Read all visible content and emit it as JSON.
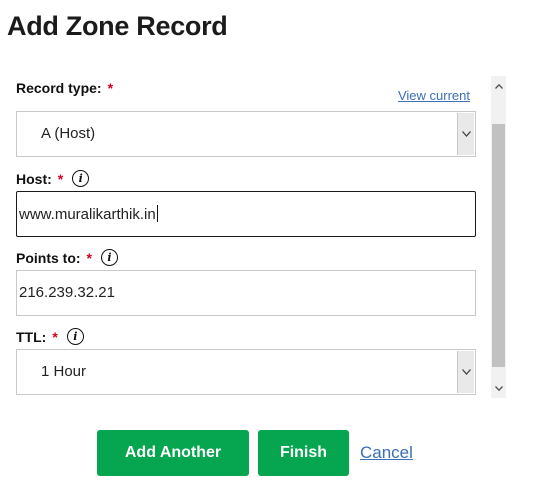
{
  "header": {
    "title": "Add Zone Record"
  },
  "form": {
    "required_mark": "*",
    "info_glyph": "i",
    "record_type": {
      "label": "Record type:",
      "value": "A (Host)",
      "view_current": "View current"
    },
    "host": {
      "label": "Host:",
      "value": "www.muralikarthik.in"
    },
    "points_to": {
      "label": "Points to:",
      "value": "216.239.32.21"
    },
    "ttl": {
      "label": "TTL:",
      "value": "1 Hour"
    }
  },
  "actions": {
    "add_another": "Add Another",
    "finish": "Finish",
    "cancel": "Cancel"
  },
  "colors": {
    "primary_button": "#06a550",
    "link": "#3b6fb6",
    "required": "#d0021b"
  },
  "icons": {
    "info": "info-circle-icon",
    "dropdown": "chevron-down-icon",
    "scroll_up": "scroll-up-arrow-icon",
    "scroll_down": "scroll-down-arrow-icon"
  }
}
